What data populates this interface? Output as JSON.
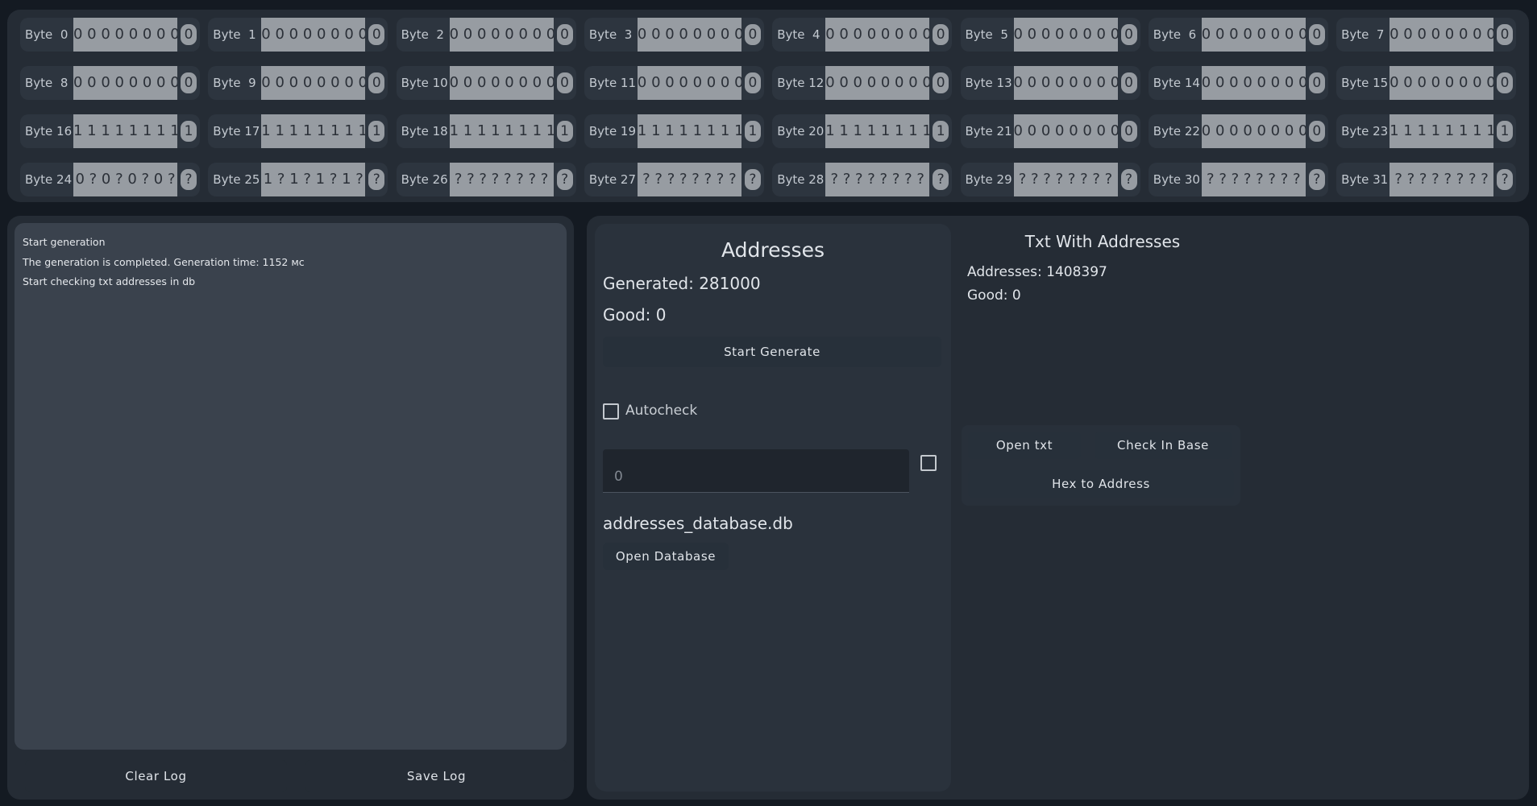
{
  "bytes": [
    {
      "label": "Byte  0",
      "bits": "0 0 0 0 0 0 0 0",
      "result": "0"
    },
    {
      "label": "Byte  1",
      "bits": "0 0 0 0 0 0 0 0",
      "result": "0"
    },
    {
      "label": "Byte  2",
      "bits": "0 0 0 0 0 0 0 0",
      "result": "0"
    },
    {
      "label": "Byte  3",
      "bits": "0 0 0 0 0 0 0 0",
      "result": "0"
    },
    {
      "label": "Byte  4",
      "bits": "0 0 0 0 0 0 0 0",
      "result": "0"
    },
    {
      "label": "Byte  5",
      "bits": "0 0 0 0 0 0 0 0",
      "result": "0"
    },
    {
      "label": "Byte  6",
      "bits": "0 0 0 0 0 0 0 0",
      "result": "0"
    },
    {
      "label": "Byte  7",
      "bits": "0 0 0 0 0 0 0 0",
      "result": "0"
    },
    {
      "label": "Byte  8",
      "bits": "0 0 0 0 0 0 0 0",
      "result": "0"
    },
    {
      "label": "Byte  9",
      "bits": "0 0 0 0 0 0 0 0",
      "result": "0"
    },
    {
      "label": "Byte 10",
      "bits": "0 0 0 0 0 0 0 0",
      "result": "0"
    },
    {
      "label": "Byte 11",
      "bits": "0 0 0 0 0 0 0 0",
      "result": "0"
    },
    {
      "label": "Byte 12",
      "bits": "0 0 0 0 0 0 0 0",
      "result": "0"
    },
    {
      "label": "Byte 13",
      "bits": "0 0 0 0 0 0 0 0",
      "result": "0"
    },
    {
      "label": "Byte 14",
      "bits": "0 0 0 0 0 0 0 0",
      "result": "0"
    },
    {
      "label": "Byte 15",
      "bits": "0 0 0 0 0 0 0 0",
      "result": "0"
    },
    {
      "label": "Byte 16",
      "bits": "1 1 1 1 1 1 1 1",
      "result": "1"
    },
    {
      "label": "Byte 17",
      "bits": "1 1 1 1 1 1 1 1",
      "result": "1"
    },
    {
      "label": "Byte 18",
      "bits": "1 1 1 1 1 1 1 1",
      "result": "1"
    },
    {
      "label": "Byte 19",
      "bits": "1 1 1 1 1 1 1 1",
      "result": "1"
    },
    {
      "label": "Byte 20",
      "bits": "1 1 1 1 1 1 1 1",
      "result": "1"
    },
    {
      "label": "Byte 21",
      "bits": "0 0 0 0 0 0 0 0",
      "result": "0"
    },
    {
      "label": "Byte 22",
      "bits": "0 0 0 0 0 0 0 0",
      "result": "0"
    },
    {
      "label": "Byte 23",
      "bits": "1 1 1 1 1 1 1 1",
      "result": "1"
    },
    {
      "label": "Byte 24",
      "bits": "0 ? 0 ? 0 ? 0 ?",
      "result": "?"
    },
    {
      "label": "Byte 25",
      "bits": "1 ? 1 ? 1 ? 1 ?",
      "result": "?"
    },
    {
      "label": "Byte 26",
      "bits": "? ? ? ? ? ? ? ?",
      "result": "?"
    },
    {
      "label": "Byte 27",
      "bits": "? ? ? ? ? ? ? ?",
      "result": "?"
    },
    {
      "label": "Byte 28",
      "bits": "? ? ? ? ? ? ? ?",
      "result": "?"
    },
    {
      "label": "Byte 29",
      "bits": "? ? ? ? ? ? ? ?",
      "result": "?"
    },
    {
      "label": "Byte 30",
      "bits": "? ? ? ? ? ? ? ?",
      "result": "?"
    },
    {
      "label": "Byte 31",
      "bits": "? ? ? ? ? ? ? ?",
      "result": "?"
    }
  ],
  "log": {
    "lines": [
      "Start generation",
      "The generation is completed. Generation time: 1152 мс",
      "Start checking txt addresses in db"
    ],
    "clear_label": "Clear Log",
    "save_label": "Save Log"
  },
  "addresses": {
    "title": "Addresses",
    "generated": "Generated: 281000",
    "good": "Good: 0",
    "start_generate_label": "Start Generate",
    "autocheck_label": "Autocheck",
    "autocheck_checked": false,
    "count_field_value": "0",
    "count_field_checked": false,
    "db_name": "addresses_database.db",
    "open_db_label": "Open Database"
  },
  "txt": {
    "title": "Txt With Addresses",
    "addresses": "Addresses: 1408397",
    "good": "Good: 0",
    "open_txt_label": "Open txt",
    "check_in_base_label": "Check In Base",
    "hex_to_address_label": "Hex to Address"
  },
  "colors": {
    "background": "#141a22",
    "panel": "#252c35",
    "bits_field": "#979ca2",
    "log_area": "#3a424d"
  }
}
